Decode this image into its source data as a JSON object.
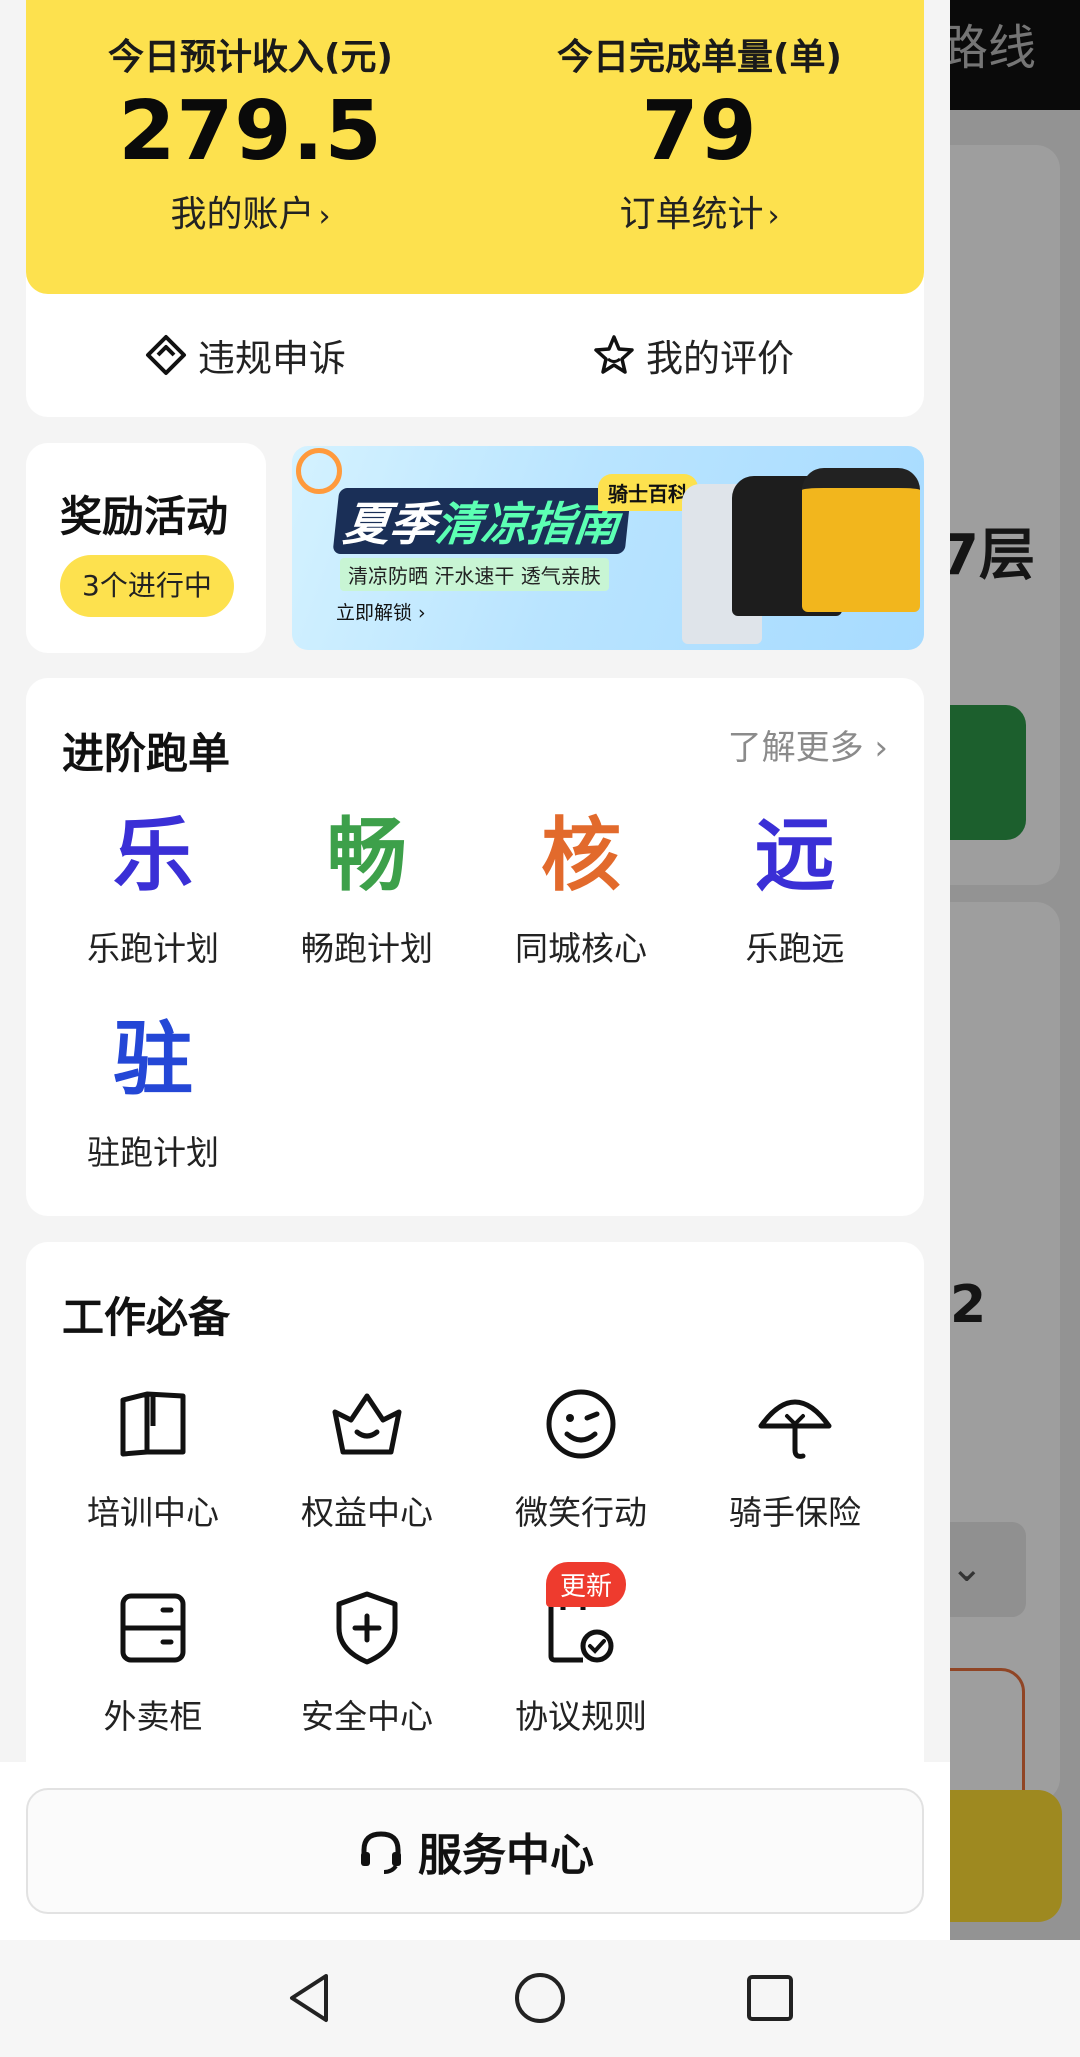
{
  "background": {
    "route_text": "路线",
    "floor_text": "7层",
    "number_text": "2"
  },
  "earnings": {
    "income_label": "今日预计收入(元)",
    "income_value": "279.5",
    "account_link": "我的账户",
    "orders_label": "今日完成单量(单)",
    "orders_value": "79",
    "stats_link": "订单统计",
    "chevron": "›"
  },
  "actions": {
    "appeal_label": "违规申诉",
    "rating_label": "我的评价"
  },
  "rewards": {
    "title": "奖励活动",
    "badge": "3个进行中"
  },
  "banner": {
    "title_part1": "夏季",
    "title_part2": "清凉指南",
    "tag": "骑士百科",
    "subtitle": "清凉防晒 汗水速干 透气亲肤",
    "unlock": "立即解锁 ›"
  },
  "advanced": {
    "title": "进阶跑单",
    "more": "了解更多 ›",
    "items": [
      {
        "glyph": "乐",
        "label": "乐跑计划",
        "color": "#3a2fd6"
      },
      {
        "glyph": "畅",
        "label": "畅跑计划",
        "color": "#3da04a"
      },
      {
        "glyph": "核",
        "label": "同城核心",
        "color": "#e26a2c"
      },
      {
        "glyph": "远",
        "label": "乐跑远",
        "color": "#3a2fd6"
      },
      {
        "glyph": "驻",
        "label": "驻跑计划",
        "color": "#2447d6"
      }
    ]
  },
  "tools": {
    "title": "工作必备",
    "items": [
      {
        "icon": "book-icon",
        "label": "培训中心"
      },
      {
        "icon": "crown-icon",
        "label": "权益中心"
      },
      {
        "icon": "smile-icon",
        "label": "微笑行动"
      },
      {
        "icon": "umbrella-icon",
        "label": "骑手保险"
      },
      {
        "icon": "locker-icon",
        "label": "外卖柜"
      },
      {
        "icon": "shield-icon",
        "label": "安全中心"
      },
      {
        "icon": "agreement-icon",
        "label": "协议规则"
      }
    ],
    "update_badge": "更新"
  },
  "service": {
    "label": "服务中心"
  },
  "colors": {
    "yellow": "#fde14e",
    "update_red": "#ee3b2e"
  }
}
